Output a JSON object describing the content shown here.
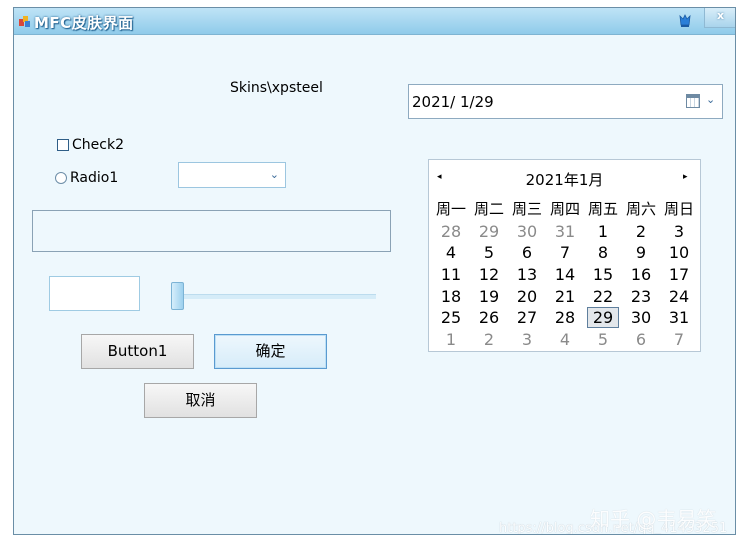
{
  "window": {
    "title": "MFC皮肤界面",
    "close_label": "x"
  },
  "skins_label": "Skins\\xpsteel",
  "datepicker": {
    "value": "2021/  1/29"
  },
  "check2_label": "Check2",
  "radio1_label": "Radio1",
  "combo": {
    "value": ""
  },
  "edit1": {
    "value": ""
  },
  "slider": {
    "value_fraction": 0.0
  },
  "buttons": {
    "button1": "Button1",
    "ok": "确定",
    "cancel": "取消"
  },
  "calendar": {
    "title": "2021年1月",
    "prev": "◂",
    "next": "▸",
    "weekdays": [
      "周一",
      "周二",
      "周三",
      "周四",
      "周五",
      "周六",
      "周日"
    ],
    "weeks": [
      [
        {
          "d": "28",
          "m": true
        },
        {
          "d": "29",
          "m": true
        },
        {
          "d": "30",
          "m": true
        },
        {
          "d": "31",
          "m": true
        },
        {
          "d": "1"
        },
        {
          "d": "2"
        },
        {
          "d": "3"
        }
      ],
      [
        {
          "d": "4"
        },
        {
          "d": "5"
        },
        {
          "d": "6"
        },
        {
          "d": "7"
        },
        {
          "d": "8"
        },
        {
          "d": "9"
        },
        {
          "d": "10"
        }
      ],
      [
        {
          "d": "11"
        },
        {
          "d": "12"
        },
        {
          "d": "13"
        },
        {
          "d": "14"
        },
        {
          "d": "15"
        },
        {
          "d": "16"
        },
        {
          "d": "17"
        }
      ],
      [
        {
          "d": "18"
        },
        {
          "d": "19"
        },
        {
          "d": "20"
        },
        {
          "d": "21"
        },
        {
          "d": "22"
        },
        {
          "d": "23"
        },
        {
          "d": "24"
        }
      ],
      [
        {
          "d": "25"
        },
        {
          "d": "26"
        },
        {
          "d": "27"
        },
        {
          "d": "28"
        },
        {
          "d": "29",
          "today": true
        },
        {
          "d": "30"
        },
        {
          "d": "31"
        }
      ],
      [
        {
          "d": "1",
          "m": true
        },
        {
          "d": "2",
          "m": true
        },
        {
          "d": "3",
          "m": true
        },
        {
          "d": "4",
          "m": true
        },
        {
          "d": "5",
          "m": true
        },
        {
          "d": "6",
          "m": true
        },
        {
          "d": "7",
          "m": true
        }
      ]
    ]
  },
  "watermark": {
    "zh": "知乎 @韦易笑",
    "url": "https://blog.csdn.net/qq_41453251"
  },
  "colors": {
    "titlebar": "#8fcbea",
    "client_bg": "#eef8fd",
    "ok_border": "#5a9ad0"
  }
}
